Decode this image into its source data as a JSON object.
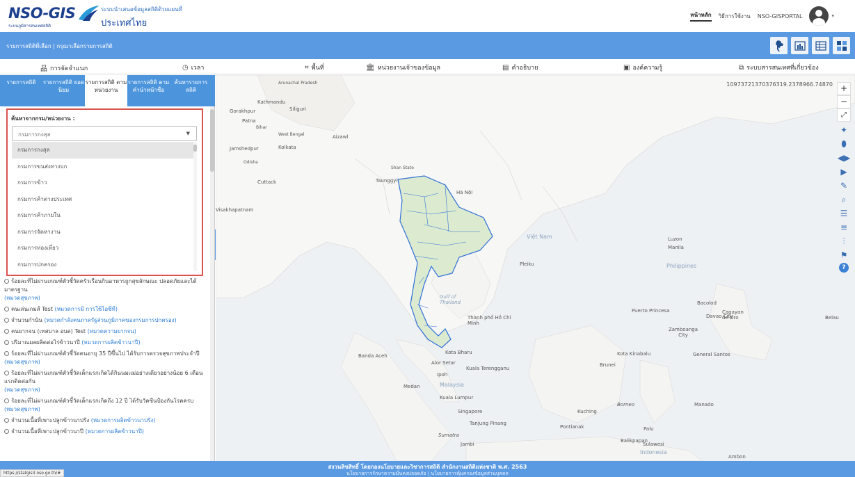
{
  "header": {
    "logo": "NSO-GIS",
    "logo_sub": "ระบบภูมิสารสนเทศสถิติ",
    "brand_line1": "ระบบนำเสนอข้อมูลสถิติด้วยแผนที่",
    "brand_line2": "ประเทศไทย",
    "nav": [
      "หน้าหลัก",
      "วิธีการใช้งาน",
      "NSO-GISPORTAL"
    ]
  },
  "bluebar": {
    "label": "รายการสถิติที่เลือก | กรุณาเลือกรายการสถิติ",
    "icons": [
      "thailand-map-icon",
      "chart-icon",
      "table-icon",
      "layout-icon"
    ]
  },
  "menu": [
    {
      "label": "การจัดจำแนก",
      "icon": "hierarchy-icon"
    },
    {
      "label": "เวลา",
      "icon": "clock-icon"
    },
    {
      "label": "พื้นที่",
      "icon": "area-icon"
    },
    {
      "label": "หน่วยงานเจ้าของข้อมูล",
      "icon": "bank-icon"
    },
    {
      "label": "คำอธิบาย",
      "icon": "description-icon"
    },
    {
      "label": "องค์ความรู้",
      "icon": "knowledge-icon"
    },
    {
      "label": "ระบบสารสนเทศที่เกี่ยวข้อง",
      "icon": "link-icon"
    }
  ],
  "tabs": [
    {
      "label": "รายการสถิติ"
    },
    {
      "label": "รายการสถิติ ยอดนิยม"
    },
    {
      "label": "รายการสถิติ ตามหน่วยงาน"
    },
    {
      "label": "รายการสถิติ ตามคำนำหน้าชื่อ"
    },
    {
      "label": "ค้นหารายการ สถิติ"
    }
  ],
  "search": {
    "title": "ค้นหาจากกรม/หน่วยงาน :",
    "selected": "กรมการกงสุล",
    "options": [
      "กรมการกงสุล",
      "กรมการขนส่งทางบก",
      "กรมการข้าว",
      "กรมการค้าต่างประเทศ",
      "กรมการค้าภายใน",
      "กรมการจัดหางาน",
      "กรมการท่องเที่ยว",
      "กรมการปกครอง"
    ]
  },
  "stats": [
    {
      "text": "ร้อยละที่ไม่ผ่านเกณฑ์ตัวชี้วัดครัวเรือนกินอาหารถูกสุขลักษณะ ปลอดภัยและได้มาตรฐาน",
      "tag": "(หมวดสุขภาพ)"
    },
    {
      "text": "คนเล่นเกมส์ Test",
      "tag": "(หมวดการมี การใช้ไอซีที)"
    },
    {
      "text": "จำนวนกำนัน",
      "tag": "(หมวดกำลังคนภาครัฐส่วนภูมิภาคของกรมการปกครอง)"
    },
    {
      "text": "คนยากจน (เทสบาล อบต) Test",
      "tag": "(หมวดความยากจน)"
    },
    {
      "text": "ปริมาณผลผลิตต่อไร่ข้าวนาปี",
      "tag": "(หมวดการผลิตข้าวนาปี)"
    },
    {
      "text": "ร้อยละที่ไม่ผ่านเกณฑ์ตัวชี้วัดคนอายุ 35 ปีขึ้นไป ได้รับการตรวจสุขภาพประจำปี",
      "tag": "(หมวดสุขภาพ)"
    },
    {
      "text": "ร้อยละที่ไม่ผ่านเกณฑ์ตัวชี้วัดเด็กแรกเกิดได้กินนมแม่อย่างเดียวอย่างน้อย 6 เดือนแรกติดต่อกัน",
      "tag": "(หมวดสุขภาพ)"
    },
    {
      "text": "ร้อยละที่ไม่ผ่านเกณฑ์ตัวชี้วัดเด็กแรกเกิดถึง 12 ปี ได้รับวัคซีนป้องกันโรคครบ",
      "tag": "(หมวดสุขภาพ)"
    },
    {
      "text": "จำนวนเนื้อที่เพาะปลูกข้าวนาปรัง",
      "tag": "(หมวดการผลิตข้าวนาปรัง)"
    },
    {
      "text": "จำนวนเนื้อที่เพาะปลูกข้าวนาปี",
      "tag": "(หมวดการผลิตข้าวนาปี)"
    }
  ],
  "map": {
    "coord": "10973721370376319.2378966.74870",
    "labels": [
      {
        "t": "Kathmandu"
      },
      {
        "t": "Gorakhpur"
      },
      {
        "t": "Patna"
      },
      {
        "t": "Siliguri"
      },
      {
        "t": "Kolkata"
      },
      {
        "t": "Jamshedpur"
      },
      {
        "t": "Cuttack"
      },
      {
        "t": "Visakhapatnam"
      },
      {
        "t": "Aizawl"
      },
      {
        "t": "Taunggyi"
      },
      {
        "t": "Hà Nội"
      },
      {
        "t": "Việt Nam"
      },
      {
        "t": "Pleiku"
      },
      {
        "t": "Thành phố Hồ Chí Minh"
      },
      {
        "t": "Gulf of Thailand"
      },
      {
        "t": "Kota Bharu"
      },
      {
        "t": "Banda Aceh"
      },
      {
        "t": "Alor Setar"
      },
      {
        "t": "Kuala Terengganu"
      },
      {
        "t": "Ipoh"
      },
      {
        "t": "Malaysia"
      },
      {
        "t": "Medan"
      },
      {
        "t": "Kuala Lumpur"
      },
      {
        "t": "Singapore"
      },
      {
        "t": "Tanjung Pinang"
      },
      {
        "t": "Sumatra"
      },
      {
        "t": "Jambi"
      },
      {
        "t": "Pontianak"
      },
      {
        "t": "Kuching"
      },
      {
        "t": "Borneo"
      },
      {
        "t": "Kota Kinabalu"
      },
      {
        "t": "Brunei"
      },
      {
        "t": "Palu"
      },
      {
        "t": "Balikpapan"
      },
      {
        "t": "Sulawesi"
      },
      {
        "t": "Indonesia"
      },
      {
        "t": "Manado"
      },
      {
        "t": "Puerto Princesa"
      },
      {
        "t": "Bacolod"
      },
      {
        "t": "Cagayan de Oro"
      },
      {
        "t": "Zamboanga City"
      },
      {
        "t": "Davao City"
      },
      {
        "t": "General Santos"
      },
      {
        "t": "Philippines"
      },
      {
        "t": "Luzon"
      },
      {
        "t": "Manila"
      },
      {
        "t": "Belau"
      },
      {
        "t": "Ambon"
      },
      {
        "t": "Arunachal Pradesh"
      },
      {
        "t": "Bihar"
      },
      {
        "t": "West Bengal"
      },
      {
        "t": "Odisha"
      },
      {
        "t": "Shan State"
      }
    ]
  },
  "footer": {
    "line1": "สงวนลิขสิทธิ์ โดยกองนโยบายและวิชาการสถิติ สำนักงานสถิติแห่งชาติ พ.ศ. 2563",
    "line2": "นโยบายการรักษาความมั่นคงปลอดภัย | นโยบายการคุ้มครองข้อมูลส่วนบุคคล"
  },
  "status_url": "https://statgis3.nso.go.th/#"
}
